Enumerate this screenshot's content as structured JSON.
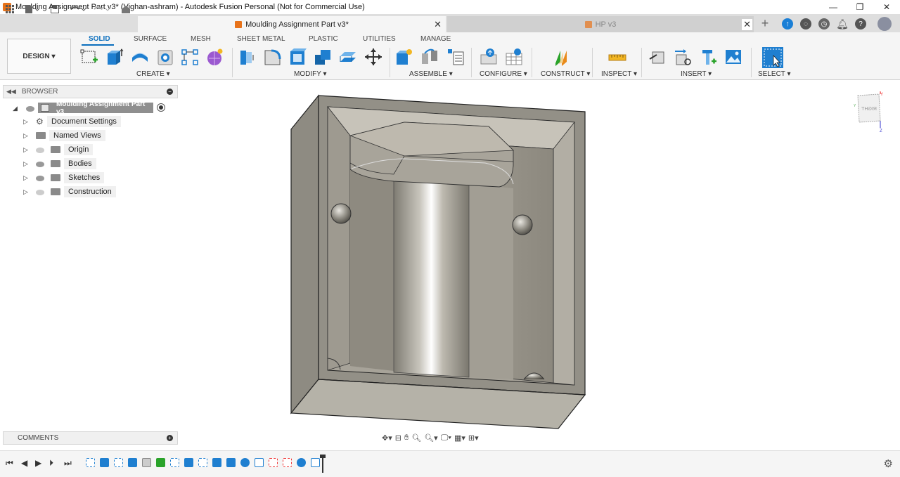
{
  "window": {
    "title": "Moulding Assignment Part v3* (Vighan-ashram) - Autodesk Fusion Personal (Not for Commercial Use)",
    "controls": [
      "—",
      "❐",
      "✕"
    ]
  },
  "tabs": {
    "active": "Moulding Assignment Part v3*",
    "inactive": "HP v3"
  },
  "ribbon": {
    "workspace": "DESIGN ▾",
    "tabs": [
      "SOLID",
      "SURFACE",
      "MESH",
      "SHEET METAL",
      "PLASTIC",
      "UTILITIES",
      "MANAGE"
    ],
    "active_tab": "SOLID",
    "groups": [
      "CREATE ▾",
      "MODIFY ▾",
      "ASSEMBLE ▾",
      "CONFIGURE ▾",
      "CONSTRUCT ▾",
      "INSPECT ▾",
      "INSERT ▾",
      "SELECT ▾"
    ]
  },
  "browser": {
    "header": "BROWSER",
    "root": "Moulding Assignment Part v3",
    "items": [
      {
        "label": "Document Settings",
        "icon": "gear-icon"
      },
      {
        "label": "Named Views",
        "icon": "folder-icon"
      },
      {
        "label": "Origin",
        "icon": "folder-icon",
        "eye": "off"
      },
      {
        "label": "Bodies",
        "icon": "folder-icon",
        "eye": "on"
      },
      {
        "label": "Sketches",
        "icon": "folder-icon",
        "eye": "on"
      },
      {
        "label": "Construction",
        "icon": "folder-icon",
        "eye": "off"
      }
    ]
  },
  "comments": {
    "label": "COMMENTS"
  },
  "viewcube": {
    "face": "RIGHT"
  },
  "colors": {
    "accent": "#0a6ebd",
    "brand_orange": "#e8731a",
    "model_grey": "#8d8a80"
  }
}
